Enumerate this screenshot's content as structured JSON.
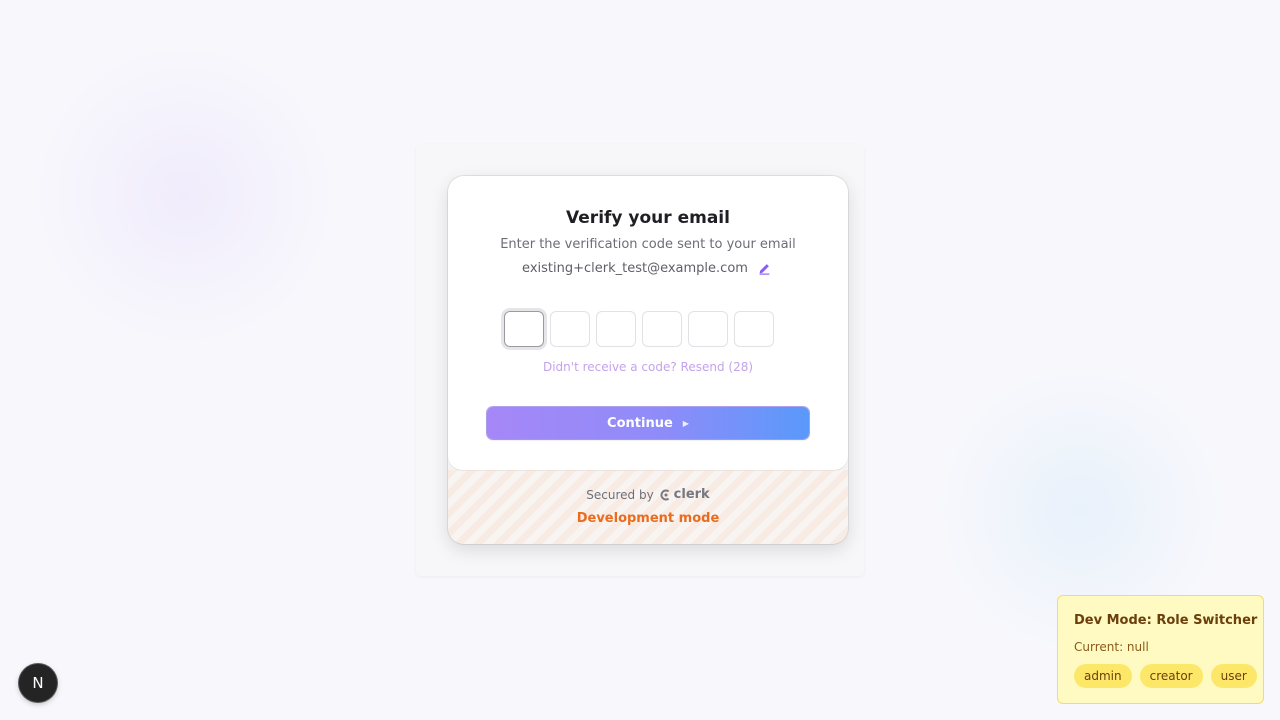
{
  "verify": {
    "title": "Verify your email",
    "subtitle": "Enter the verification code sent to your email",
    "email": "existing+clerk_test@example.com",
    "edit_icon": "pencil-icon",
    "otp_digits": [
      "",
      "",
      "",
      "",
      "",
      ""
    ],
    "resend_text": "Didn't receive a code? Resend (28)",
    "continue_label": "Continue",
    "continue_icon": "caret-right-icon"
  },
  "footer": {
    "secured_by": "Secured by",
    "brand": "clerk",
    "dev_mode": "Development mode"
  },
  "nextjs_badge": {
    "label": "N"
  },
  "role_switcher": {
    "title": "Dev Mode: Role Switcher",
    "current": "Current: null",
    "roles": [
      "admin",
      "creator",
      "user"
    ]
  },
  "colors": {
    "accent_purple": "#a687f7",
    "accent_blue": "#5a99fa",
    "dev_mode_orange": "#ea6c1e",
    "role_panel_bg": "#fff9c2"
  }
}
